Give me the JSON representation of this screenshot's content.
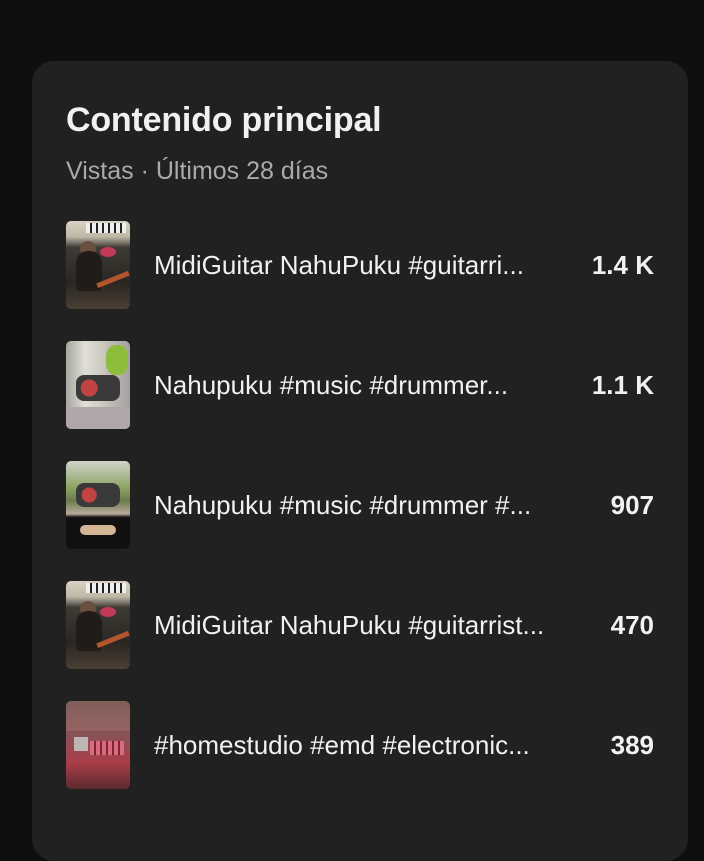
{
  "card": {
    "title": "Contenido principal",
    "subtitle": "Vistas · Últimos 28 días"
  },
  "items": [
    {
      "title": "MidiGuitar NahuPuku #guitarri...",
      "views": "1.4 K",
      "thumbnail": "guitar-player-thumbnail"
    },
    {
      "title": "Nahupuku #music #drummer...",
      "views": "1.1 K",
      "thumbnail": "drummer-thumbnail"
    },
    {
      "title": "Nahupuku #music #drummer #...",
      "views": "907",
      "thumbnail": "drummer-thumbnail"
    },
    {
      "title": "MidiGuitar NahuPuku #guitarrist...",
      "views": "470",
      "thumbnail": "guitar-player-thumbnail"
    },
    {
      "title": "#homestudio #emd #electronic...",
      "views": "389",
      "thumbnail": "home-studio-thumbnail"
    }
  ],
  "colors": {
    "page_background": "#0f0f0f",
    "card_background": "#212121",
    "primary_text": "#f1f1f1",
    "secondary_text": "#aaaaaa"
  }
}
